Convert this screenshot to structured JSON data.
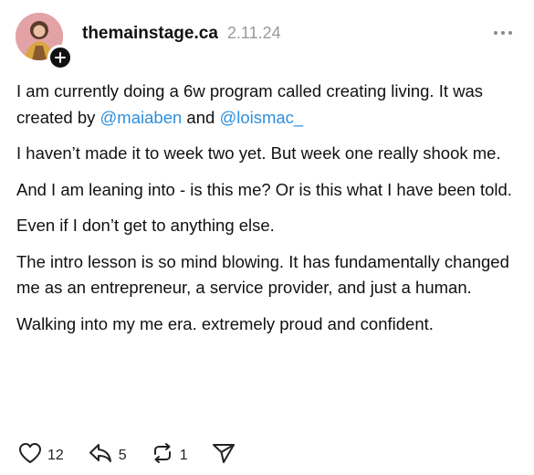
{
  "post": {
    "username": "themainstage.ca",
    "date": "2.11.24",
    "paragraphs": {
      "p1_text": "I am currently doing a 6w program called creating living.  It was created by ",
      "p1_mention1": "@maiaben",
      "p1_and": " and ",
      "p1_mention2": "@loismac_",
      "p2": "I haven’t made it to week two yet.  But week one really shook me.",
      "p3": "And I am leaning into - is this me? Or is this what I have been told.",
      "p4": "Even if I don’t get to anything else.",
      "p5": "The intro lesson is so mind blowing. It has fundamentally changed me as an entrepreneur, a service provider, and just a human.",
      "p6": "Walking into my me era.  extremely proud and confident."
    },
    "actions": {
      "likes": "12",
      "comments": "5",
      "reposts": "1"
    }
  },
  "colors": {
    "mention": "#2e8fdc",
    "muted": "#9a9a9a"
  },
  "icons": [
    "follow-plus-icon",
    "more-dots-icon",
    "heart-icon",
    "comment-icon",
    "repost-icon",
    "share-send-icon"
  ]
}
